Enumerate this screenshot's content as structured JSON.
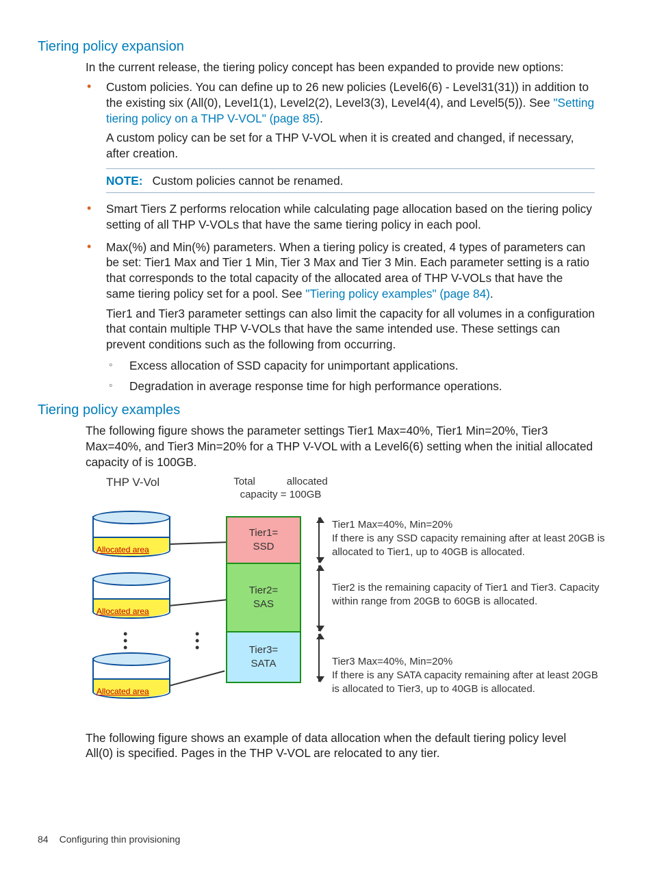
{
  "heading1": "Tiering policy expansion",
  "intro": "In the current release, the tiering policy concept has been expanded to provide new options:",
  "bullets": {
    "b1_a": "Custom policies. You can define up to 26 new policies (Level6(6) - Level31(31)) in addition to the existing six (All(0), Level1(1), Level2(2), Level3(3), Level4(4), and Level5(5)). See ",
    "b1_link": "\"Setting tiering policy on a THP V-VOL\" (page 85)",
    "b1_b": ".",
    "b1_p2": "A custom policy can be set for a THP V-VOL when it is created and changed, if necessary, after creation.",
    "note_label": "NOTE:",
    "note_text": "Custom policies cannot be renamed.",
    "b2": "Smart Tiers Z performs relocation while calculating page allocation based on the tiering policy setting of all THP V-VOLs that have the same tiering policy in each pool.",
    "b3_a": "Max(%) and Min(%) parameters. When a tiering policy is created, 4 types of parameters can be set: Tier1 Max and Tier 1 Min, Tier 3 Max and Tier 3 Min. Each parameter setting is a ratio that corresponds to the total capacity of the allocated area of THP V-VOLs that have the same tiering policy set for a pool. See ",
    "b3_link": "\"Tiering policy examples\" (page 84)",
    "b3_b": ".",
    "b3_p2": "Tier1 and Tier3 parameter settings can also limit the capacity for all volumes in a configuration that contain multiple THP V-VOLs that have the same intended use. These settings can prevent conditions such as the following from occurring.",
    "sub1": "Excess allocation of SSD capacity for unimportant applications.",
    "sub2": "Degradation in average response time for high performance operations."
  },
  "heading2": "Tiering policy examples",
  "examples_intro": "The following figure shows the parameter settings Tier1 Max=40%, Tier1 Min=20%, Tier3 Max=40%, and Tier3 Min=20% for a THP V-VOL with a Level6(6) setting when the initial allocated capacity of is 100GB.",
  "figure": {
    "vvol_label": "THP V-Vol",
    "alloc": "Allocated area",
    "totcap_l1": "Total           allocated",
    "totcap_l2": "capacity  = 100GB",
    "tier1": "Tier1=\nSSD",
    "tier2": "Tier2=\nSAS",
    "tier3": "Tier3=\nSATA",
    "txt1": "Tier1 Max=40%, Min=20%\nIf there is any SSD capacity remaining after at least 20GB is allocated to Tier1, up to 40GB is allocated.",
    "txt2": "Tier2 is the remaining capacity of Tier1 and Tier3. Capacity within range from 20GB to 60GB is allocated.",
    "txt3": "Tier3 Max=40%, Min=20%\nIf there is any SATA capacity remaining after at least 20GB is allocated to Tier3, up to 40GB is allocated."
  },
  "after_fig": "The following figure shows an example of data allocation when the default tiering policy level All(0) is specified. Pages in the THP V-VOL are relocated to any tier.",
  "footer_page": "84",
  "footer_title": "Configuring thin provisioning"
}
